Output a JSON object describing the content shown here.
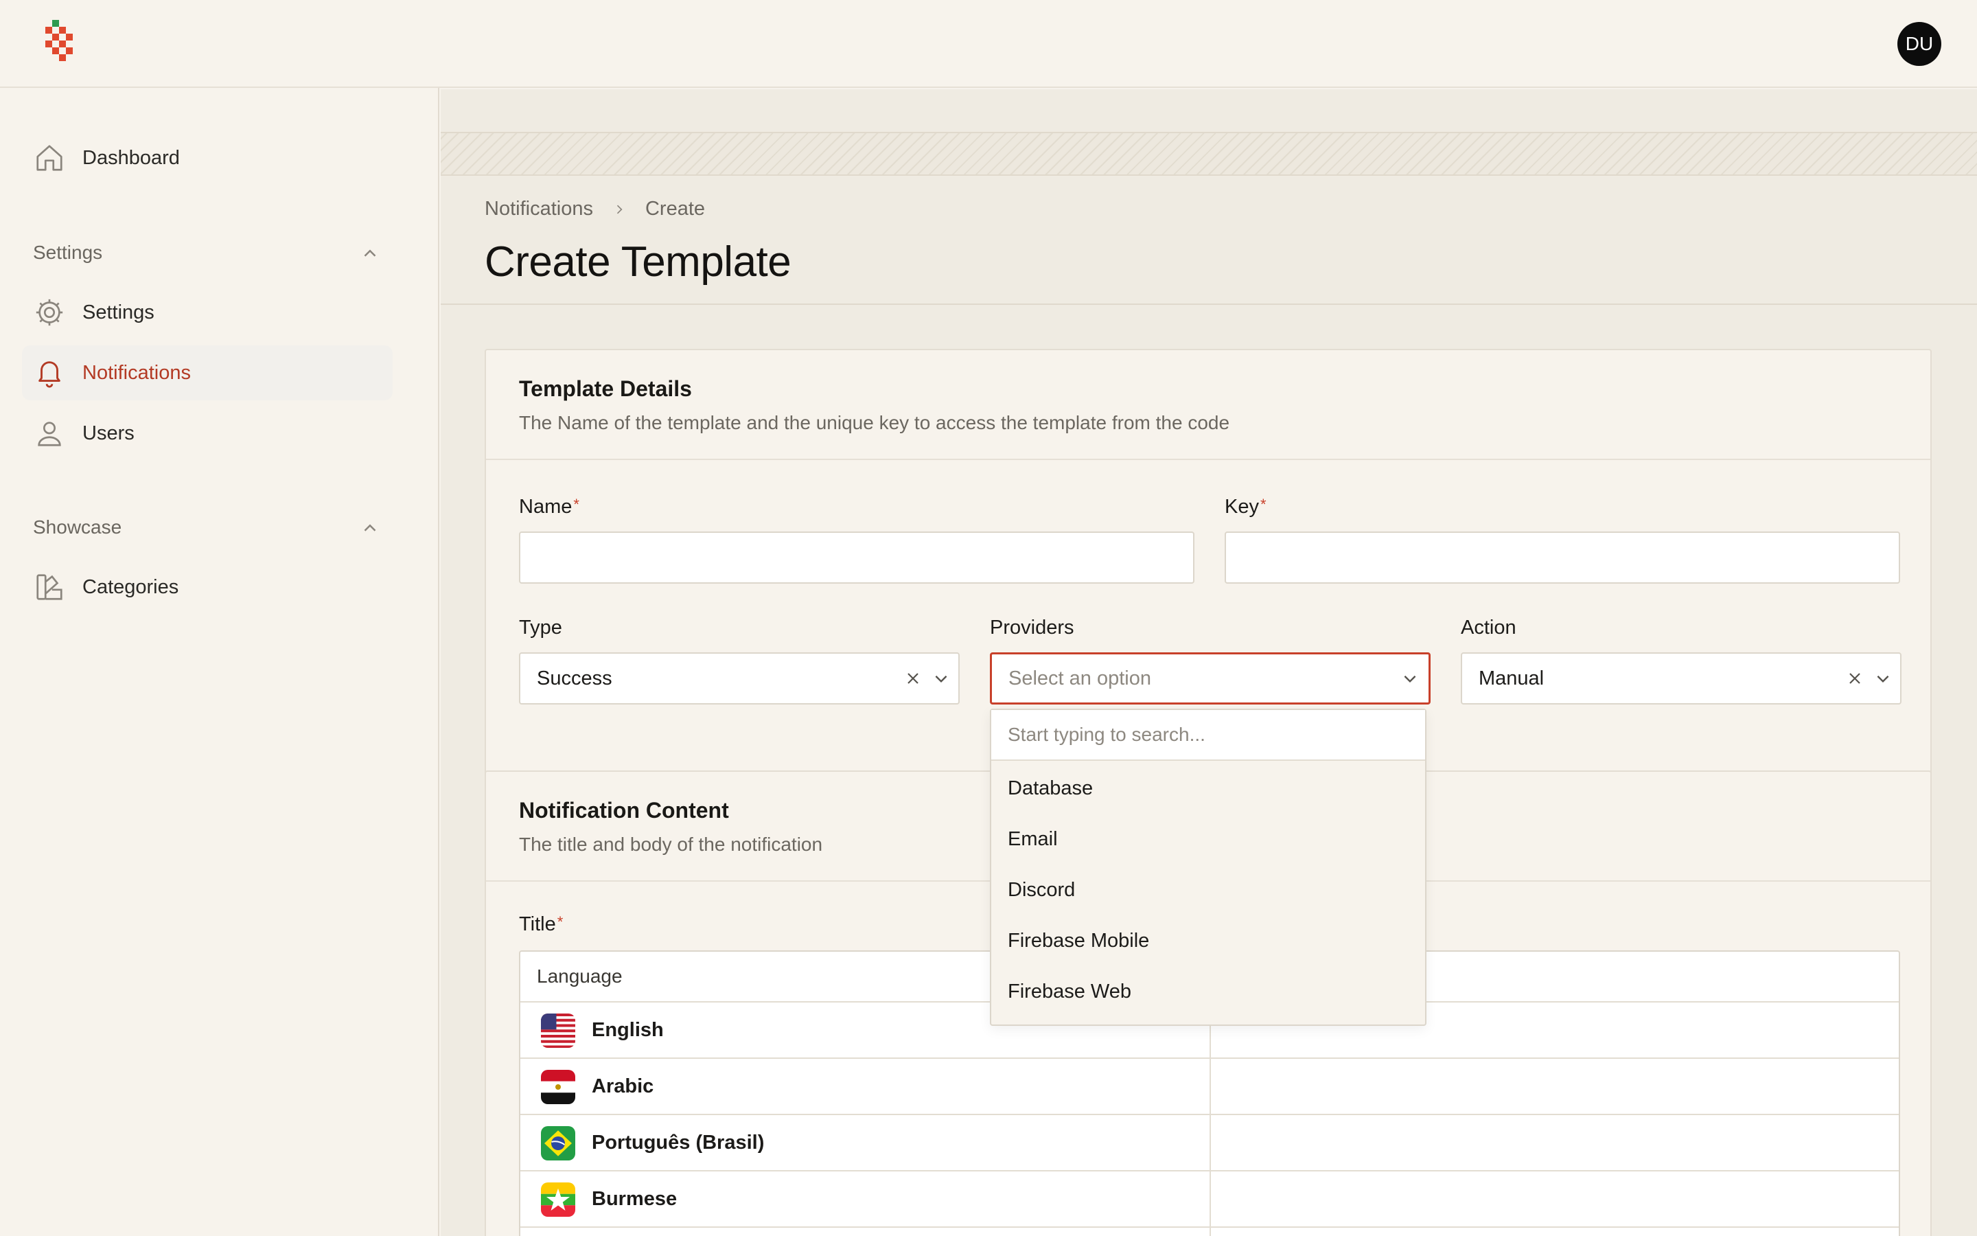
{
  "header": {
    "avatar_initials": "DU"
  },
  "sidebar": {
    "dashboard": "Dashboard",
    "groups": [
      {
        "label": "Settings",
        "items": [
          "Settings",
          "Notifications",
          "Users"
        ]
      },
      {
        "label": "Showcase",
        "items": [
          "Categories"
        ]
      }
    ],
    "active_item": "Notifications"
  },
  "breadcrumb": [
    "Notifications",
    "Create"
  ],
  "page_title": "Create Template",
  "template_details": {
    "title": "Template Details",
    "subtitle": "The Name of the template and the unique key to access the template from the code",
    "name_label": "Name",
    "name_value": "",
    "key_label": "Key",
    "key_value": "",
    "required_mark": "*",
    "type_label": "Type",
    "type_value": "Success",
    "providers_label": "Providers",
    "providers_placeholder": "Select an option",
    "action_label": "Action",
    "action_value": "Manual"
  },
  "providers_dropdown": {
    "search_placeholder": "Start typing to search...",
    "options": [
      "Database",
      "Email",
      "Discord",
      "Firebase Mobile",
      "Firebase Web"
    ]
  },
  "notification_content": {
    "title": "Notification Content",
    "subtitle": "The title and body of the notification",
    "title_label": "Title",
    "table_header": "Language",
    "languages": [
      "English",
      "Arabic",
      "Português (Brasil)",
      "Burmese"
    ]
  },
  "colors": {
    "accent": "#c8402a",
    "background": "#f7f3ec",
    "main_background": "#efebe2"
  }
}
